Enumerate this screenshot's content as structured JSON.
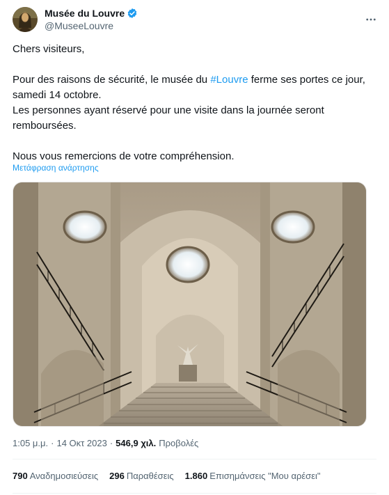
{
  "header": {
    "display_name": "Musée du Louvre",
    "handle": "@MuseeLouvre",
    "more_icon": "more-horizontal-icon",
    "verified_icon": "verified-badge-icon",
    "accent": "#1d9bf0"
  },
  "tweet": {
    "greeting": "Chers visiteurs,",
    "line1_before": "Pour des raisons de sécurité, le musée du ",
    "hashtag": "#Louvre",
    "line1_after": " ferme ses portes ce jour, samedi 14 octobre.",
    "line2": "Les personnes ayant réservé pour une visite dans la journée seront remboursées.",
    "line3": "Nous vous remercions de votre compréhension.",
    "translate_link": "Μετάφραση ανάρτησης"
  },
  "meta": {
    "time": "1:05 μ.μ.",
    "separator": "·",
    "date": "14 Οκτ 2023",
    "views_count": "546,9 χιλ.",
    "views_label": "Προβολές"
  },
  "stats": {
    "reposts_count": "790",
    "reposts_label": "Αναδημοσιεύσεις",
    "quotes_count": "296",
    "quotes_label": "Παραθέσεις",
    "likes_count": "1.860",
    "likes_label": "Επισημάνσεις \"Μου αρέσει\""
  }
}
